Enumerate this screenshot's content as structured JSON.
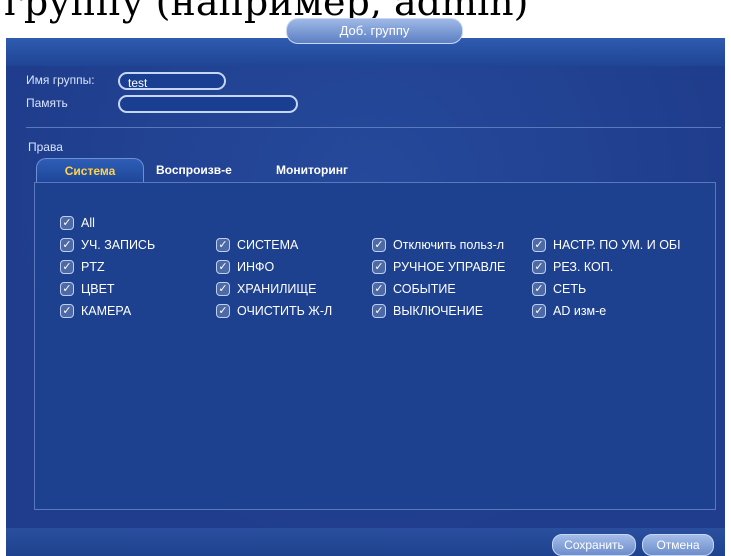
{
  "page_caption": "группу (например, admin)",
  "dialog": {
    "title": "Доб. группу",
    "group_name_label": "Имя группы:",
    "group_name_value": "test",
    "memo_label": "Память",
    "memo_value": "",
    "rights_label": "Права"
  },
  "tabs": [
    {
      "label": "Система",
      "active": true
    },
    {
      "label": "Воспроизв-е",
      "active": false
    },
    {
      "label": "Мониторинг",
      "active": false
    }
  ],
  "permissions": {
    "all": "All",
    "col1": [
      "УЧ. ЗАПИСЬ",
      "PTZ",
      "ЦВЕТ",
      "КАМЕРА"
    ],
    "col2": [
      "СИСТЕМА",
      "ИНФО",
      "ХРАНИЛИЩЕ",
      "ОЧИСТИТЬ Ж-Л"
    ],
    "col3": [
      "Отключить польз-л",
      "РУЧНОЕ УПРАВЛЕ",
      "СОБЫТИЕ",
      "ВЫКЛЮЧЕНИЕ"
    ],
    "col4": [
      "НАСТР. ПО УМ. И ОБI",
      "РЕЗ. КОП.",
      "СЕТЬ",
      "AD изм-е"
    ]
  },
  "buttons": {
    "save": "Сохранить",
    "cancel": "Отмена"
  },
  "colors": {
    "dialog_bg": "#1f3d8c",
    "active_tab_text": "#ffd34a"
  }
}
